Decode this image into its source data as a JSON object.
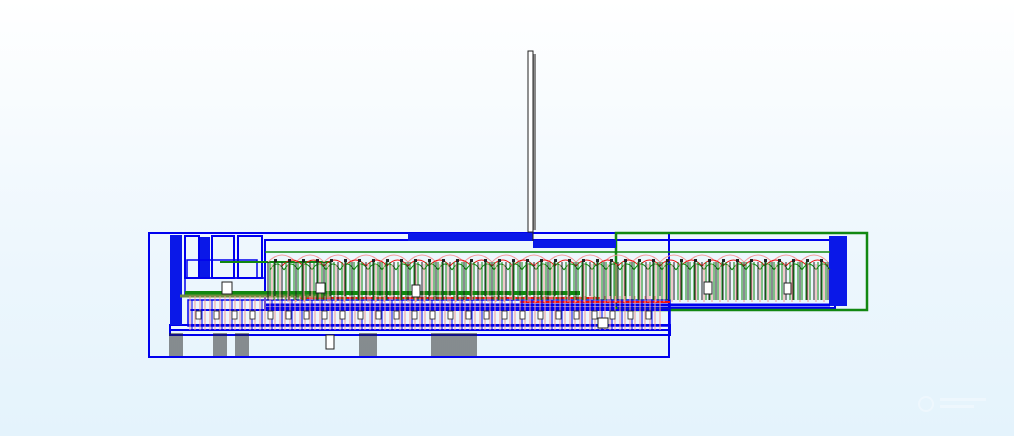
{
  "diagram": {
    "type": "hierarchical circuit layout",
    "palette": {
      "background_top": "#ffffff",
      "background_bottom": "#e4f3fc",
      "block_outline": "#0000ee",
      "block_fill": "#0a18e8",
      "net_green": "#118811",
      "wire_red": "#ee1111",
      "wire_pink": "#f29a9a",
      "pin_dark": "#222222",
      "wire_olive": "#6f8f3f"
    },
    "icons": [
      "antenna-mast-icon",
      "watermark-logo-icon"
    ]
  }
}
